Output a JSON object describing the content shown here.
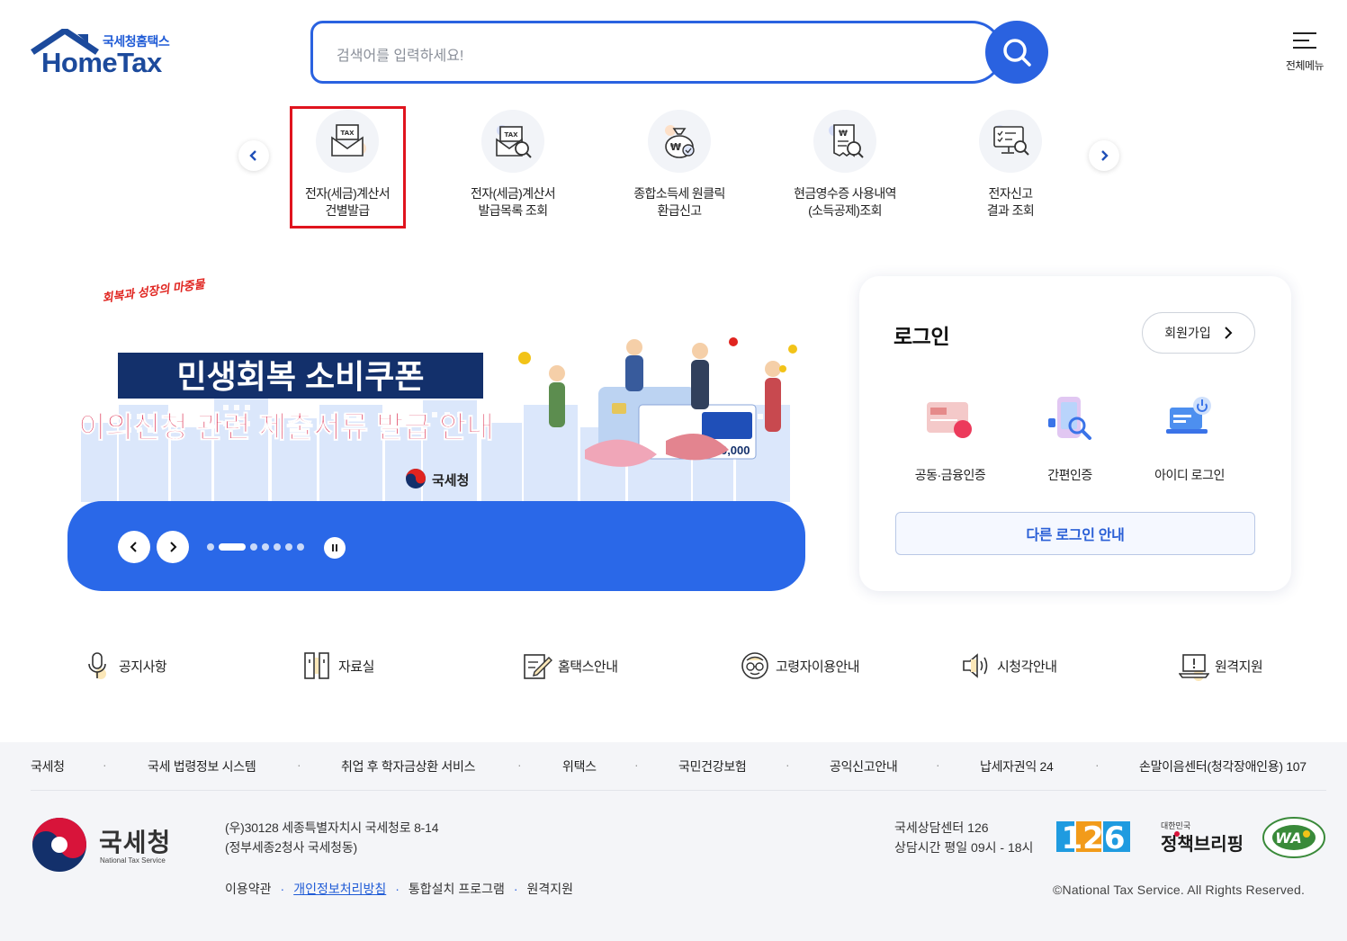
{
  "header": {
    "logo_kr": "국세청홈택스",
    "logo_en": "HomeTax",
    "search_placeholder": "검색어를 입력하세요!",
    "all_menu_label": "전체메뉴"
  },
  "quick_menu": [
    {
      "line1": "전자(세금)계산서",
      "line2": "건별발급",
      "icon": "tax-invoice-envelope-icon"
    },
    {
      "line1": "전자(세금)계산서",
      "line2": "발급목록 조회",
      "icon": "tax-invoice-search-icon"
    },
    {
      "line1": "종합소득세 원클릭",
      "line2": "환급신고",
      "icon": "won-money-bag-icon"
    },
    {
      "line1": "현금영수증 사용내역",
      "line2": "(소득공제)조회",
      "icon": "receipt-search-icon"
    },
    {
      "line1": "전자신고",
      "line2": "결과 조회",
      "icon": "monitor-check-icon"
    }
  ],
  "banner": {
    "badge_text": "회복과 성장의 마중물",
    "title": "민생회복 소비쿠폰",
    "subtitle": "이의신청 관련 제출서류 발급 안내",
    "org": "국세청",
    "card_amount": "150,000",
    "slide_count": 7,
    "active_slide": 1
  },
  "login": {
    "title": "로그인",
    "join_label": "회원가입",
    "options": [
      {
        "label": "공동·금융인증",
        "icon": "certificate-card-icon"
      },
      {
        "label": "간편인증",
        "icon": "phone-search-icon"
      },
      {
        "label": "아이디 로그인",
        "icon": "laptop-power-icon"
      }
    ],
    "other_login_label": "다른 로그인 안내"
  },
  "shortcuts": [
    {
      "label": "공지사항",
      "icon": "microphone-icon"
    },
    {
      "label": "자료실",
      "icon": "bookshelf-icon"
    },
    {
      "label": "홈택스안내",
      "icon": "document-pencil-icon"
    },
    {
      "label": "고령자이용안내",
      "icon": "elderly-glasses-icon"
    },
    {
      "label": "시청각안내",
      "icon": "speaker-icon"
    },
    {
      "label": "원격지원",
      "icon": "laptop-alert-icon"
    }
  ],
  "footer": {
    "links": [
      "국세청",
      "국세 법령정보 시스템",
      "취업 후 학자금상환 서비스",
      "위택스",
      "국민건강보험",
      "공익신고안내",
      "납세자권익 24",
      "손말이음센터(청각장애인용) 107"
    ],
    "nts_kr": "국세청",
    "nts_en": "National Tax Service",
    "address_line1": "(우)30128 세종특별자치시 국세청로 8-14",
    "address_line2": "(정부세종2청사 국세청동)",
    "policy_links": [
      "이용약관",
      "개인정보처리방침",
      "통합설치 프로그램",
      "원격지원"
    ],
    "center_line1": "국세상담센터 126",
    "center_line2": "상담시간 평일 09시 - 18시",
    "badge_126": "126",
    "policy_brief_small": "대한민국",
    "policy_brief": "정책브리핑",
    "wa_text": "WA",
    "copyright": "©National Tax Service. All Rights Reserved."
  },
  "colors": {
    "primary": "#2a62e0",
    "banner_bar": "#2a68e8",
    "highlight": "#e0141e",
    "footer_bg": "#f4f5f8"
  }
}
